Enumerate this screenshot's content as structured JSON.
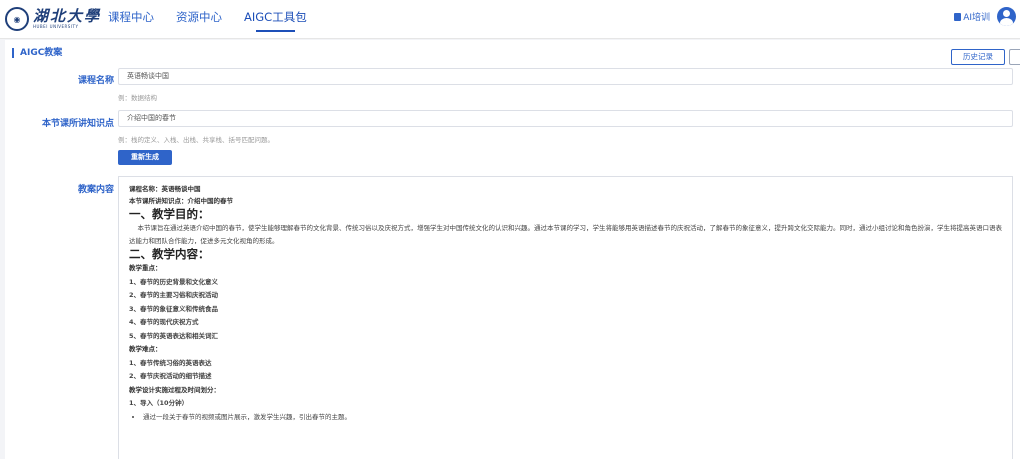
{
  "header": {
    "logo_cn": "湖北大學",
    "logo_en": "HUBEI UNIVERSITY",
    "nav": [
      {
        "label": "课程中心"
      },
      {
        "label": "资源中心"
      },
      {
        "label": "AIGC工具包"
      }
    ],
    "ai_training": "AI培训"
  },
  "panel": {
    "title": "AIGC教案",
    "history_button": "历史记录"
  },
  "form": {
    "course_label": "课程名称",
    "course_value": "英语畅谈中国",
    "course_hint": "例：数据结构",
    "point_label": "本节课所讲知识点",
    "point_value": "介绍中国的春节",
    "point_hint": "例：栈的定义、入栈、出栈、共享栈、括号匹配问题。",
    "regen_button": "重新生成",
    "content_label": "教案内容"
  },
  "lesson": {
    "course_line": "课程名称：英语畅谈中国",
    "point_line": "本节课所讲知识点：介绍中国的春节",
    "h1": "一、教学目的：",
    "purpose": "本节课旨在通过英语介绍中国的春节，使学生能够理解春节的文化背景、传统习俗以及庆祝方式，增强学生对中国传统文化的认识和兴趣。通过本节课的学习，学生将能够用英语描述春节的庆祝活动，了解春节的象征意义，提升跨文化交际能力。同时，通过小组讨论和角色扮演，学生将提高英语口语表达能力和团队合作能力，促进多元文化视角的形成。",
    "h2": "二、教学内容：",
    "key_title": "教学重点：",
    "key_points": [
      "1、春节的历史背景和文化意义",
      "2、春节的主要习俗和庆祝活动",
      "3、春节的象征意义和传统食品",
      "4、春节的现代庆祝方式",
      "5、春节的英语表达和相关词汇"
    ],
    "difficult_title": "教学难点：",
    "difficult_points": [
      "1、春节传统习俗的英语表达",
      "2、春节庆祝活动的细节描述"
    ],
    "design_title": "教学设计实施过程及时间划分：",
    "step1": "1、导入（10分钟）",
    "step1_bullet": "通过一段关于春节的视频或图片展示，激发学生兴趣，引出春节的主题。"
  }
}
